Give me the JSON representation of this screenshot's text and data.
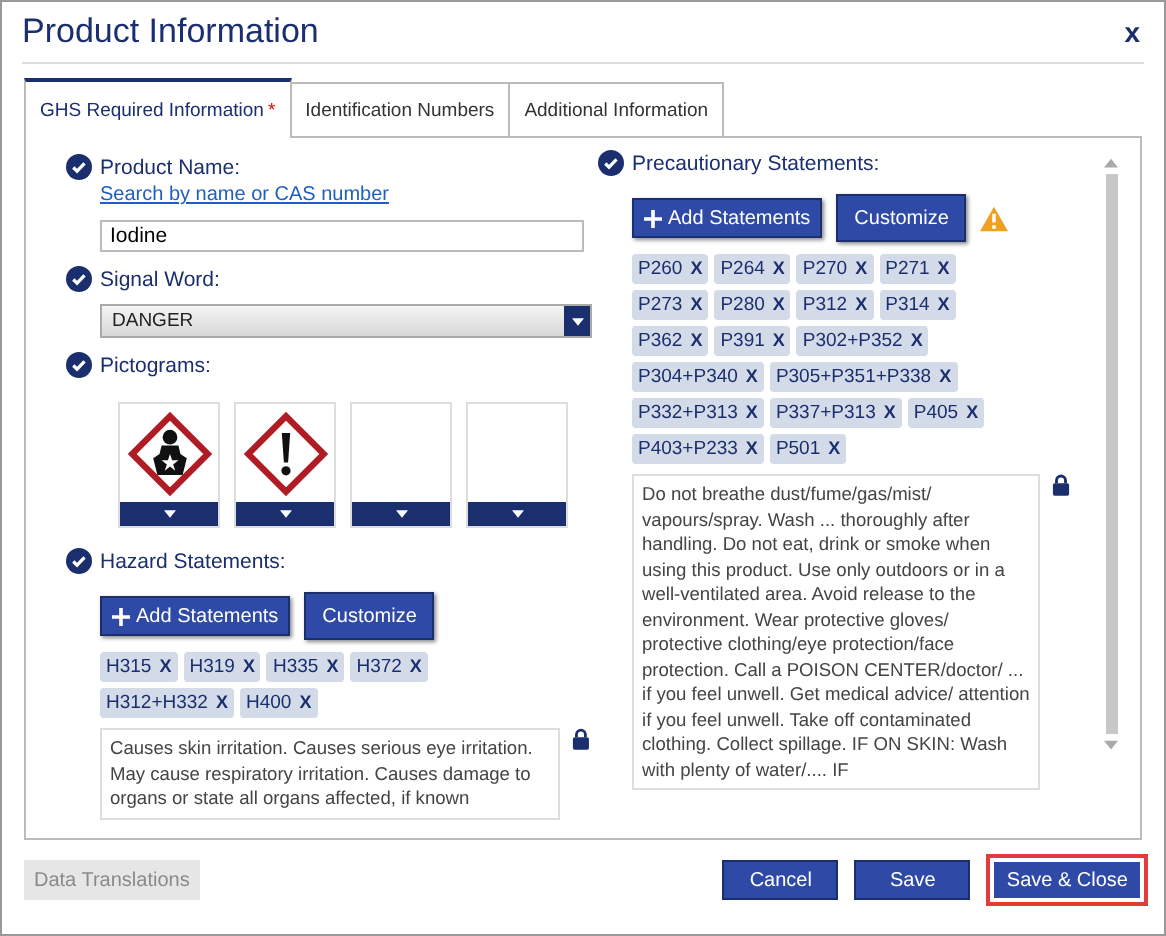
{
  "window": {
    "title": "Product Information",
    "close": "x"
  },
  "tabs": [
    {
      "label": "GHS Required Information",
      "required_mark": "*",
      "selected": true
    },
    {
      "label": "Identification Numbers",
      "selected": false
    },
    {
      "label": "Additional Information",
      "selected": false
    }
  ],
  "product_name": {
    "label": "Product Name:",
    "link": "Search by name or CAS number",
    "value": "Iodine"
  },
  "signal_word": {
    "label": "Signal Word:",
    "value": "DANGER"
  },
  "pictograms": {
    "label": "Pictograms:",
    "items": [
      {
        "kind": "health-hazard"
      },
      {
        "kind": "exclamation"
      },
      {
        "kind": "empty"
      },
      {
        "kind": "empty"
      }
    ]
  },
  "hazard_statements": {
    "label": "Hazard Statements:",
    "add_button": "Add Statements",
    "customize_button": "Customize",
    "codes": [
      {
        "code": "H315",
        "remove": "X"
      },
      {
        "code": "H319",
        "remove": "X"
      },
      {
        "code": "H335",
        "remove": "X"
      },
      {
        "code": "H372",
        "remove": "X"
      },
      {
        "code": "H312+H332",
        "remove": "X"
      },
      {
        "code": "H400",
        "remove": "X"
      }
    ],
    "text": "Causes skin irritation. Causes serious eye irritation. May cause respiratory irritation. Causes damage to organs or state all organs affected, if known"
  },
  "precautionary_statements": {
    "label": "Precautionary Statements:",
    "add_button": "Add Statements",
    "customize_button": "Customize",
    "warning": true,
    "codes": [
      {
        "code": "P260",
        "remove": "X"
      },
      {
        "code": "P264",
        "remove": "X"
      },
      {
        "code": "P270",
        "remove": "X"
      },
      {
        "code": "P271",
        "remove": "X"
      },
      {
        "code": "P273",
        "remove": "X"
      },
      {
        "code": "P280",
        "remove": "X"
      },
      {
        "code": "P312",
        "remove": "X"
      },
      {
        "code": "P314",
        "remove": "X"
      },
      {
        "code": "P362",
        "remove": "X"
      },
      {
        "code": "P391",
        "remove": "X"
      },
      {
        "code": "P302+P352",
        "remove": "X"
      },
      {
        "code": "P304+P340",
        "remove": "X"
      },
      {
        "code": "P305+P351+P338",
        "remove": "X"
      },
      {
        "code": "P332+P313",
        "remove": "X"
      },
      {
        "code": "P337+P313",
        "remove": "X"
      },
      {
        "code": "P405",
        "remove": "X"
      },
      {
        "code": "P403+P233",
        "remove": "X"
      },
      {
        "code": "P501",
        "remove": "X"
      }
    ],
    "text": "Do not breathe dust/fume/gas/mist/ vapours/spray. Wash ... thoroughly after handling. Do not eat, drink or smoke when using this product. Use only outdoors or in a well-ventilated area. Avoid release to the environment. Wear protective gloves/ protective clothing/eye protection/face protection. Call a POISON CENTER/doctor/ ... if you feel unwell. Get medical advice/ attention if you feel unwell. Take off contaminated clothing. Collect spillage. IF ON SKIN:  Wash with plenty of water/.... IF"
  },
  "footer": {
    "translations_button": {
      "label": "Data Translations",
      "disabled": true
    },
    "buttons": [
      {
        "label": "Cancel",
        "highlighted": false
      },
      {
        "label": "Save",
        "highlighted": false
      },
      {
        "label": "Save & Close",
        "highlighted": true
      }
    ]
  }
}
